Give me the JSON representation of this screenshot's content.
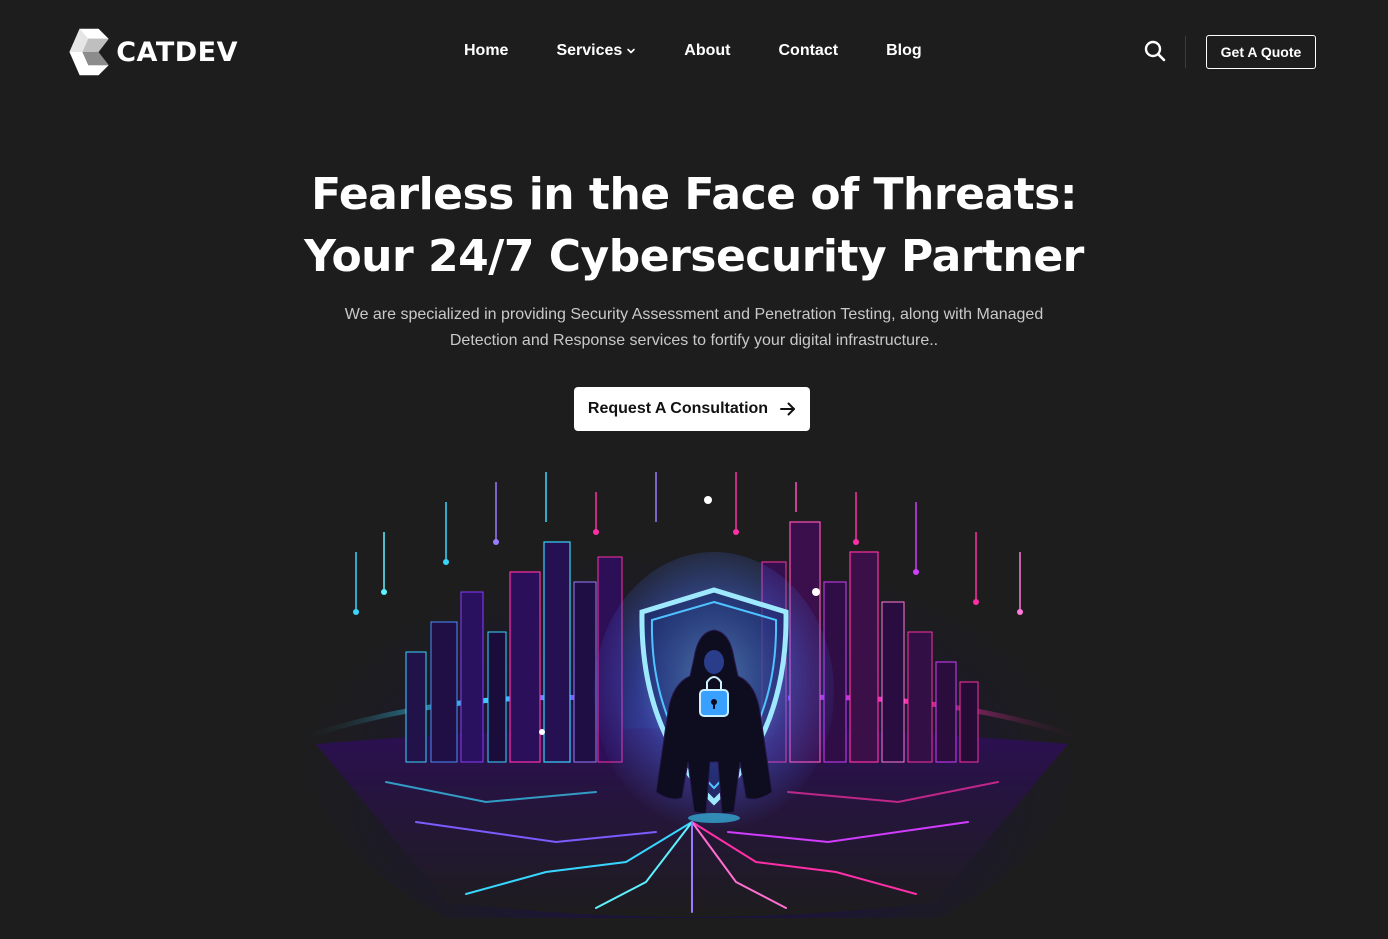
{
  "brand": {
    "name": "CATDEV"
  },
  "nav": {
    "items": [
      {
        "label": "Home"
      },
      {
        "label": "Services",
        "has_dropdown": true
      },
      {
        "label": "About"
      },
      {
        "label": "Contact"
      },
      {
        "label": "Blog"
      }
    ]
  },
  "header_actions": {
    "search_icon": "search-icon",
    "quote_label": "Get A Quote"
  },
  "hero": {
    "title_line1": "Fearless in the Face of Threats:",
    "title_line2": "Your 24/7 Cybersecurity Partner",
    "description": "We are specialized in providing Security Assessment and Penetration Testing, along with Managed Detection and Response services to fortify your digital infrastructure..",
    "cta_label": "Request A Consultation",
    "cta_icon": "arrow-right-icon"
  },
  "colors": {
    "background": "#1d1d1d",
    "text": "#ffffff",
    "muted_text": "#c9c9c9",
    "neon_cyan": "#38d6ff",
    "neon_magenta": "#ff2fa8",
    "neon_purple": "#8a3cff"
  }
}
